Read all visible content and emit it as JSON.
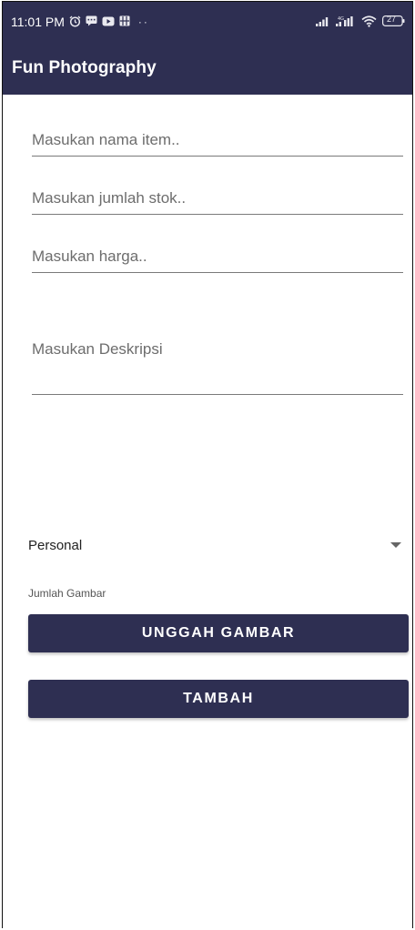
{
  "status_bar": {
    "time": "11:01 PM",
    "left_icons": [
      "alarm-icon",
      "message-icon",
      "youtube-icon",
      "gallery-icon",
      "more-dots-icon"
    ],
    "right_icons": [
      "signal-icon",
      "4g-signal-icon",
      "wifi-icon",
      "battery-icon"
    ],
    "battery": "27"
  },
  "app_bar": {
    "title": "Fun Photography"
  },
  "form": {
    "item_name_placeholder": "Masukan nama item..",
    "stock_placeholder": "Masukan jumlah stok..",
    "price_placeholder": "Masukan harga..",
    "description_placeholder": "Masukan Deskripsi",
    "category_selected": "Personal",
    "image_count_label": "Jumlah Gambar",
    "upload_button": "UNGGAH GAMBAR",
    "add_button": "TAMBAH"
  },
  "colors": {
    "primary": "#2e2f52",
    "background": "#ffffff",
    "underline": "#7a7a7a"
  }
}
